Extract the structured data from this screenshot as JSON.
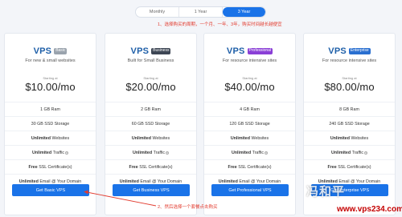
{
  "billing": {
    "options": [
      "Monthly",
      "1 Year",
      "3 Year"
    ],
    "selected": "3 Year"
  },
  "annotations": {
    "top": "1、选择购买的周期，一个月、一年、3年，购买时间越长越便宜",
    "bottom": "2、然后选择一个套餐点击购买"
  },
  "plans": [
    {
      "name": "VPS",
      "badge": "Basic",
      "badge_color": "#9aa3ad",
      "tagline": "For new & small websites",
      "starting": "Starting at",
      "price": "$10.00/mo",
      "features": [
        {
          "strong": "",
          "text": "1 GB Ram"
        },
        {
          "strong": "",
          "text": "30 GB SSD Storage"
        },
        {
          "strong": "Unlimited",
          "text": "Websites"
        },
        {
          "strong": "Unlimited",
          "text": "Traffic"
        },
        {
          "strong": "Free",
          "text": "SSL Certificate(s)"
        },
        {
          "strong": "Unlimited",
          "text": "Email @ Your Domain"
        }
      ],
      "cta": "Get Basic VPS"
    },
    {
      "name": "VPS",
      "badge": "Business",
      "badge_color": "#3d4654",
      "tagline": "Built for Small Business",
      "starting": "Starting at",
      "price": "$20.00/mo",
      "features": [
        {
          "strong": "",
          "text": "2 GB Ram"
        },
        {
          "strong": "",
          "text": "60 GB SSD Storage"
        },
        {
          "strong": "Unlimited",
          "text": "Websites"
        },
        {
          "strong": "Unlimited",
          "text": "Traffic"
        },
        {
          "strong": "Free",
          "text": "SSL Certificate(s)"
        },
        {
          "strong": "Unlimited",
          "text": "Email @ Your Domain"
        }
      ],
      "cta": "Get Business VPS"
    },
    {
      "name": "VPS",
      "badge": "Professional",
      "badge_color": "#8a3fd6",
      "tagline": "For resource intensive sites",
      "starting": "Starting at",
      "price": "$40.00/mo",
      "features": [
        {
          "strong": "",
          "text": "4 GB Ram"
        },
        {
          "strong": "",
          "text": "120 GB SSD Storage"
        },
        {
          "strong": "Unlimited",
          "text": "Websites"
        },
        {
          "strong": "Unlimited",
          "text": "Traffic"
        },
        {
          "strong": "Free",
          "text": "SSL Certificate(s)"
        },
        {
          "strong": "Unlimited",
          "text": "Email @ Your Domain"
        }
      ],
      "cta": "Get Professional VPS"
    },
    {
      "name": "VPS",
      "badge": "Enterprise",
      "badge_color": "#2a6fd0",
      "tagline": "For resource intensive sites",
      "starting": "Starting at",
      "price": "$80.00/mo",
      "features": [
        {
          "strong": "",
          "text": "8 GB Ram"
        },
        {
          "strong": "",
          "text": "240 GB SSD Storage"
        },
        {
          "strong": "Unlimited",
          "text": "Websites"
        },
        {
          "strong": "Unlimited",
          "text": "Traffic"
        },
        {
          "strong": "Free",
          "text": "SSL Certificate(s)"
        },
        {
          "strong": "Unlimited",
          "text": "Email @ Your Domain"
        }
      ],
      "cta": "Get Enterprise VPS"
    }
  ],
  "watermark": {
    "logo": "冯和平",
    "url": "www.vps234.com"
  },
  "colors": {
    "accent": "#1a73e8",
    "title": "#1e5fa8",
    "annotation": "#e23b2e",
    "watermark_url": "#c40000"
  },
  "icons": {
    "info": "info-icon",
    "arrow": "annotation-arrow"
  }
}
